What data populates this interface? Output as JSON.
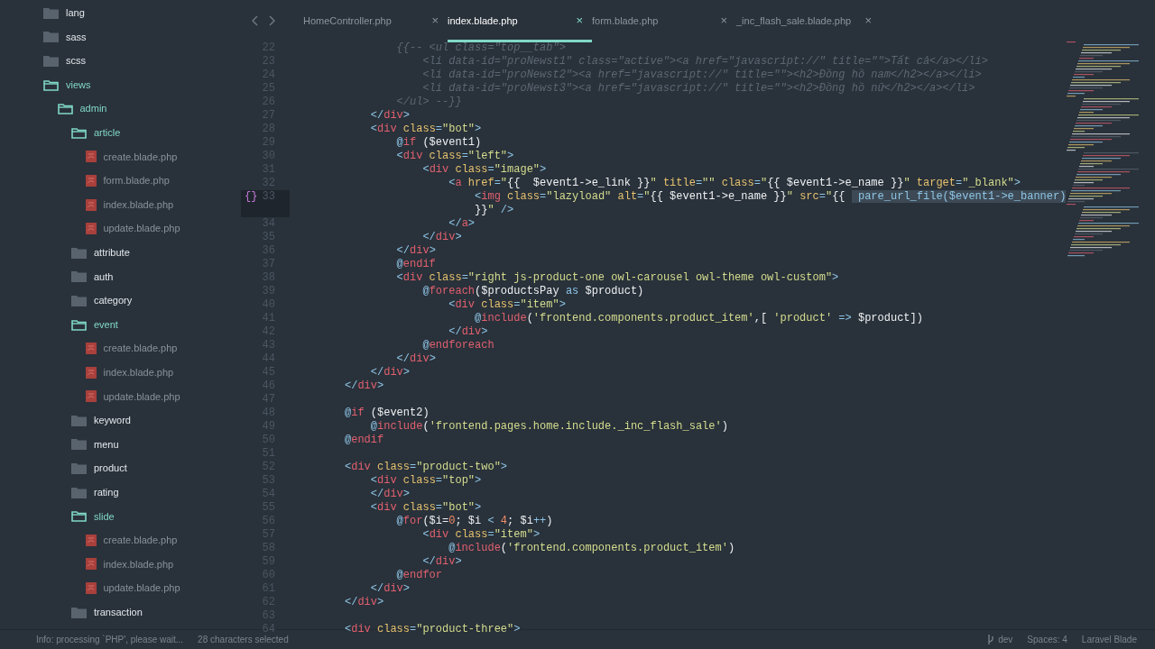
{
  "tree": [
    {
      "kind": "folder",
      "label": "lang",
      "expanded": false
    },
    {
      "kind": "folder",
      "label": "sass",
      "expanded": false
    },
    {
      "kind": "folder",
      "label": "scss",
      "expanded": false
    },
    {
      "kind": "folder",
      "label": "views",
      "expanded": true,
      "children": [
        {
          "kind": "folder",
          "label": "admin",
          "expanded": true,
          "children": [
            {
              "kind": "folder",
              "label": "article",
              "expanded": true,
              "children": [
                {
                  "kind": "file",
                  "label": "create.blade.php"
                },
                {
                  "kind": "file",
                  "label": "form.blade.php"
                },
                {
                  "kind": "file",
                  "label": "index.blade.php"
                },
                {
                  "kind": "file",
                  "label": "update.blade.php"
                }
              ]
            },
            {
              "kind": "folder",
              "label": "attribute",
              "expanded": false
            },
            {
              "kind": "folder",
              "label": "auth",
              "expanded": false
            },
            {
              "kind": "folder",
              "label": "category",
              "expanded": false
            },
            {
              "kind": "folder",
              "label": "event",
              "expanded": true,
              "children": [
                {
                  "kind": "file",
                  "label": "create.blade.php"
                },
                {
                  "kind": "file",
                  "label": "index.blade.php"
                },
                {
                  "kind": "file",
                  "label": "update.blade.php"
                }
              ]
            },
            {
              "kind": "folder",
              "label": "keyword",
              "expanded": false
            },
            {
              "kind": "folder",
              "label": "menu",
              "expanded": false
            },
            {
              "kind": "folder",
              "label": "product",
              "expanded": false
            },
            {
              "kind": "folder",
              "label": "rating",
              "expanded": false
            },
            {
              "kind": "folder",
              "label": "slide",
              "expanded": true,
              "children": [
                {
                  "kind": "file",
                  "label": "create.blade.php"
                },
                {
                  "kind": "file",
                  "label": "index.blade.php"
                },
                {
                  "kind": "file",
                  "label": "update.blade.php"
                }
              ]
            },
            {
              "kind": "folder",
              "label": "transaction",
              "expanded": false
            }
          ]
        }
      ]
    }
  ],
  "tabs": [
    {
      "label": "HomeController.php",
      "close": "×",
      "selected": false
    },
    {
      "label": "index.blade.php",
      "close": "×",
      "selected": true
    },
    {
      "label": "form.blade.php",
      "close": "×",
      "selected": false
    },
    {
      "label": "_inc_flash_sale.blade.php",
      "close": "×",
      "selected": false
    }
  ],
  "code": [
    {
      "n": "22",
      "tokens": [
        {
          "kind": "comment",
          "text": "        {{-- <ul class=\"top__tab\">"
        }
      ]
    },
    {
      "n": "23",
      "tokens": [
        {
          "kind": "comment",
          "text": "            <li data-id=\"proNewst1\" class=\"active\"><a href=\"javascript://\" title=\"\">Tất cả</a></li>"
        }
      ]
    },
    {
      "n": "24",
      "tokens": [
        {
          "kind": "comment",
          "text": "            <li data-id=\"proNewst2\"><a href=\"javascript://\" title=\"\"><h2>Đồng hồ nam</h2></a></li>"
        }
      ]
    },
    {
      "n": "25",
      "tokens": [
        {
          "kind": "comment",
          "text": "            <li data-id=\"proNewst3\"><a href=\"javascript://\" title=\"\"><h2>Đồng hồ nữ</h2></a></li>"
        }
      ]
    },
    {
      "n": "26",
      "tokens": [
        {
          "kind": "comment",
          "text": "        </ul> --}}"
        }
      ]
    },
    {
      "n": "27",
      "tokens": [
        {
          "kind": "punct",
          "text": "    </"
        },
        {
          "kind": "tag",
          "text": "div"
        },
        {
          "kind": "punct",
          "text": ">"
        }
      ]
    },
    {
      "n": "28",
      "tokens": [
        {
          "kind": "punct",
          "text": "    <"
        },
        {
          "kind": "tag",
          "text": "div"
        },
        {
          "kind": "attr",
          "text": " class"
        },
        {
          "kind": "punct",
          "text": "="
        },
        {
          "kind": "string",
          "text": "\"bot\""
        },
        {
          "kind": "punct",
          "text": ">"
        }
      ]
    },
    {
      "n": "29",
      "tokens": [
        {
          "kind": "at",
          "text": "        @"
        },
        {
          "kind": "keyword",
          "text": "if"
        },
        {
          "kind": "plain",
          "text": " ($event1)"
        }
      ]
    },
    {
      "n": "30",
      "tokens": [
        {
          "kind": "punct",
          "text": "        <"
        },
        {
          "kind": "tag",
          "text": "div"
        },
        {
          "kind": "attr",
          "text": " class"
        },
        {
          "kind": "punct",
          "text": "="
        },
        {
          "kind": "string",
          "text": "\"left\""
        },
        {
          "kind": "punct",
          "text": ">"
        }
      ]
    },
    {
      "n": "31",
      "tokens": [
        {
          "kind": "punct",
          "text": "            <"
        },
        {
          "kind": "tag",
          "text": "div"
        },
        {
          "kind": "attr",
          "text": " class"
        },
        {
          "kind": "punct",
          "text": "="
        },
        {
          "kind": "string",
          "text": "\"image\""
        },
        {
          "kind": "punct",
          "text": ">"
        }
      ]
    },
    {
      "n": "32",
      "tokens": [
        {
          "kind": "punct",
          "text": "                <"
        },
        {
          "kind": "tag",
          "text": "a"
        },
        {
          "kind": "attr",
          "text": " href"
        },
        {
          "kind": "punct",
          "text": "="
        },
        {
          "kind": "string",
          "text": "\""
        },
        {
          "kind": "plain",
          "text": "{{  $event1->e_link }}"
        },
        {
          "kind": "string",
          "text": "\""
        },
        {
          "kind": "attr",
          "text": " title"
        },
        {
          "kind": "punct",
          "text": "="
        },
        {
          "kind": "string",
          "text": "\"\""
        },
        {
          "kind": "attr",
          "text": " class"
        },
        {
          "kind": "punct",
          "text": "="
        },
        {
          "kind": "string",
          "text": "\""
        },
        {
          "kind": "plain",
          "text": "{{ $event1->e_name }}"
        },
        {
          "kind": "string",
          "text": "\""
        },
        {
          "kind": "attr",
          "text": " target"
        },
        {
          "kind": "punct",
          "text": "="
        },
        {
          "kind": "string",
          "text": "\"_blank\""
        },
        {
          "kind": "punct",
          "text": ">"
        }
      ]
    },
    {
      "n": "33",
      "current": true,
      "gutter_mark": "{}",
      "tokens": [
        {
          "kind": "punct",
          "text": "                    <"
        },
        {
          "kind": "tag",
          "text": "img"
        },
        {
          "kind": "attr",
          "text": " class"
        },
        {
          "kind": "punct",
          "text": "="
        },
        {
          "kind": "string",
          "text": "\"lazyload\""
        },
        {
          "kind": "attr",
          "text": " alt"
        },
        {
          "kind": "punct",
          "text": "="
        },
        {
          "kind": "string",
          "text": "\""
        },
        {
          "kind": "plain",
          "text": "{{ $event1->e_name }}"
        },
        {
          "kind": "string",
          "text": "\""
        },
        {
          "kind": "attr",
          "text": " src"
        },
        {
          "kind": "punct",
          "text": "="
        },
        {
          "kind": "string",
          "text": "\""
        },
        {
          "kind": "plain",
          "text": "{{ "
        },
        {
          "kind": "selected",
          "text": " pare_url_file($event1->e_banner)"
        }
      ],
      "wrap": [
        {
          "kind": "plain",
          "text": "                    }}"
        },
        {
          "kind": "string",
          "text": "\""
        },
        {
          "kind": "punct",
          "text": " />"
        }
      ]
    },
    {
      "n": "34",
      "tokens": [
        {
          "kind": "punct",
          "text": "                </"
        },
        {
          "kind": "tag",
          "text": "a"
        },
        {
          "kind": "punct",
          "text": ">"
        }
      ]
    },
    {
      "n": "35",
      "tokens": [
        {
          "kind": "punct",
          "text": "            </"
        },
        {
          "kind": "tag",
          "text": "div"
        },
        {
          "kind": "punct",
          "text": ">"
        }
      ]
    },
    {
      "n": "36",
      "tokens": [
        {
          "kind": "punct",
          "text": "        </"
        },
        {
          "kind": "tag",
          "text": "div"
        },
        {
          "kind": "punct",
          "text": ">"
        }
      ]
    },
    {
      "n": "37",
      "tokens": [
        {
          "kind": "at",
          "text": "        @"
        },
        {
          "kind": "keyword",
          "text": "endif"
        }
      ]
    },
    {
      "n": "38",
      "tokens": [
        {
          "kind": "punct",
          "text": "        <"
        },
        {
          "kind": "tag",
          "text": "div"
        },
        {
          "kind": "attr",
          "text": " class"
        },
        {
          "kind": "punct",
          "text": "="
        },
        {
          "kind": "string",
          "text": "\"right js-product-one owl-carousel owl-theme owl-custom\""
        },
        {
          "kind": "punct",
          "text": ">"
        }
      ]
    },
    {
      "n": "39",
      "tokens": [
        {
          "kind": "at",
          "text": "            @"
        },
        {
          "kind": "keyword",
          "text": "foreach"
        },
        {
          "kind": "plain",
          "text": "($productsPay "
        },
        {
          "kind": "punct",
          "text": "as"
        },
        {
          "kind": "plain",
          "text": " $product)"
        }
      ]
    },
    {
      "n": "40",
      "tokens": [
        {
          "kind": "punct",
          "text": "                <"
        },
        {
          "kind": "tag",
          "text": "div"
        },
        {
          "kind": "attr",
          "text": " class"
        },
        {
          "kind": "punct",
          "text": "="
        },
        {
          "kind": "string",
          "text": "\"item\""
        },
        {
          "kind": "punct",
          "text": ">"
        }
      ]
    },
    {
      "n": "41",
      "tokens": [
        {
          "kind": "at",
          "text": "                    @"
        },
        {
          "kind": "keyword",
          "text": "include"
        },
        {
          "kind": "plain",
          "text": "("
        },
        {
          "kind": "string",
          "text": "'frontend.components.product_item'"
        },
        {
          "kind": "plain",
          "text": ",[ "
        },
        {
          "kind": "string",
          "text": "'product'"
        },
        {
          "kind": "punct",
          "text": " => "
        },
        {
          "kind": "plain",
          "text": "$product])"
        }
      ]
    },
    {
      "n": "42",
      "tokens": [
        {
          "kind": "punct",
          "text": "                </"
        },
        {
          "kind": "tag",
          "text": "div"
        },
        {
          "kind": "punct",
          "text": ">"
        }
      ]
    },
    {
      "n": "43",
      "tokens": [
        {
          "kind": "at",
          "text": "            @"
        },
        {
          "kind": "keyword",
          "text": "endforeach"
        }
      ]
    },
    {
      "n": "44",
      "tokens": [
        {
          "kind": "punct",
          "text": "        </"
        },
        {
          "kind": "tag",
          "text": "div"
        },
        {
          "kind": "punct",
          "text": ">"
        }
      ]
    },
    {
      "n": "45",
      "tokens": [
        {
          "kind": "punct",
          "text": "    </"
        },
        {
          "kind": "tag",
          "text": "div"
        },
        {
          "kind": "punct",
          "text": ">"
        }
      ]
    },
    {
      "n": "46",
      "tokens": [
        {
          "kind": "punct",
          "text": "</"
        },
        {
          "kind": "tag",
          "text": "div"
        },
        {
          "kind": "punct",
          "text": ">"
        }
      ]
    },
    {
      "n": "47"
    },
    {
      "n": "48",
      "tokens": [
        {
          "kind": "at",
          "text": "@"
        },
        {
          "kind": "keyword",
          "text": "if"
        },
        {
          "kind": "plain",
          "text": " ($event2)"
        }
      ]
    },
    {
      "n": "49",
      "tokens": [
        {
          "kind": "at",
          "text": "    @"
        },
        {
          "kind": "keyword",
          "text": "include"
        },
        {
          "kind": "plain",
          "text": "("
        },
        {
          "kind": "string",
          "text": "'frontend.pages.home.include._inc_flash_sale'"
        },
        {
          "kind": "plain",
          "text": ")"
        }
      ]
    },
    {
      "n": "50",
      "tokens": [
        {
          "kind": "at",
          "text": "@"
        },
        {
          "kind": "keyword",
          "text": "endif"
        }
      ]
    },
    {
      "n": "51"
    },
    {
      "n": "52",
      "tokens": [
        {
          "kind": "punct",
          "text": "<"
        },
        {
          "kind": "tag",
          "text": "div"
        },
        {
          "kind": "attr",
          "text": " class"
        },
        {
          "kind": "punct",
          "text": "="
        },
        {
          "kind": "string",
          "text": "\"product-two\""
        },
        {
          "kind": "punct",
          "text": ">"
        }
      ]
    },
    {
      "n": "53",
      "tokens": [
        {
          "kind": "punct",
          "text": "    <"
        },
        {
          "kind": "tag",
          "text": "div"
        },
        {
          "kind": "attr",
          "text": " class"
        },
        {
          "kind": "punct",
          "text": "="
        },
        {
          "kind": "string",
          "text": "\"top\""
        },
        {
          "kind": "punct",
          "text": ">"
        }
      ]
    },
    {
      "n": "54",
      "tokens": [
        {
          "kind": "punct",
          "text": "    </"
        },
        {
          "kind": "tag",
          "text": "div"
        },
        {
          "kind": "punct",
          "text": ">"
        }
      ]
    },
    {
      "n": "55",
      "tokens": [
        {
          "kind": "punct",
          "text": "    <"
        },
        {
          "kind": "tag",
          "text": "div"
        },
        {
          "kind": "attr",
          "text": " class"
        },
        {
          "kind": "punct",
          "text": "="
        },
        {
          "kind": "string",
          "text": "\"bot\""
        },
        {
          "kind": "punct",
          "text": ">"
        }
      ]
    },
    {
      "n": "56",
      "tokens": [
        {
          "kind": "at",
          "text": "        @"
        },
        {
          "kind": "keyword",
          "text": "for"
        },
        {
          "kind": "plain",
          "text": "($i="
        },
        {
          "kind": "number",
          "text": "0"
        },
        {
          "kind": "plain",
          "text": "; $i "
        },
        {
          "kind": "punct",
          "text": "<"
        },
        {
          "kind": "number",
          "text": " 4"
        },
        {
          "kind": "plain",
          "text": "; $i"
        },
        {
          "kind": "punct",
          "text": "++"
        },
        {
          "kind": "plain",
          "text": ")"
        }
      ]
    },
    {
      "n": "57",
      "tokens": [
        {
          "kind": "punct",
          "text": "            <"
        },
        {
          "kind": "tag",
          "text": "div"
        },
        {
          "kind": "attr",
          "text": " class"
        },
        {
          "kind": "punct",
          "text": "="
        },
        {
          "kind": "string",
          "text": "\"item\""
        },
        {
          "kind": "punct",
          "text": ">"
        }
      ]
    },
    {
      "n": "58",
      "tokens": [
        {
          "kind": "at",
          "text": "                @"
        },
        {
          "kind": "keyword",
          "text": "include"
        },
        {
          "kind": "plain",
          "text": "("
        },
        {
          "kind": "string",
          "text": "'frontend.components.product_item'"
        },
        {
          "kind": "plain",
          "text": ")"
        }
      ]
    },
    {
      "n": "59",
      "tokens": [
        {
          "kind": "punct",
          "text": "            </"
        },
        {
          "kind": "tag",
          "text": "div"
        },
        {
          "kind": "punct",
          "text": ">"
        }
      ]
    },
    {
      "n": "60",
      "tokens": [
        {
          "kind": "at",
          "text": "        @"
        },
        {
          "kind": "keyword",
          "text": "endfor"
        }
      ]
    },
    {
      "n": "61",
      "tokens": [
        {
          "kind": "punct",
          "text": "    </"
        },
        {
          "kind": "tag",
          "text": "div"
        },
        {
          "kind": "punct",
          "text": ">"
        }
      ]
    },
    {
      "n": "62",
      "tokens": [
        {
          "kind": "punct",
          "text": "</"
        },
        {
          "kind": "tag",
          "text": "div"
        },
        {
          "kind": "punct",
          "text": ">"
        }
      ]
    },
    {
      "n": "63"
    },
    {
      "n": "64",
      "tokens": [
        {
          "kind": "punct",
          "text": "<"
        },
        {
          "kind": "tag",
          "text": "div"
        },
        {
          "kind": "attr",
          "text": " class"
        },
        {
          "kind": "punct",
          "text": "="
        },
        {
          "kind": "string",
          "text": "\"product-three\""
        },
        {
          "kind": "punct",
          "text": ">"
        }
      ]
    }
  ],
  "status_bar": {
    "message": "Info: processing `PHP', please wait...",
    "selection": "28 characters selected",
    "branch": "dev",
    "indent": "Spaces: 4",
    "grammar": "Laravel Blade"
  }
}
